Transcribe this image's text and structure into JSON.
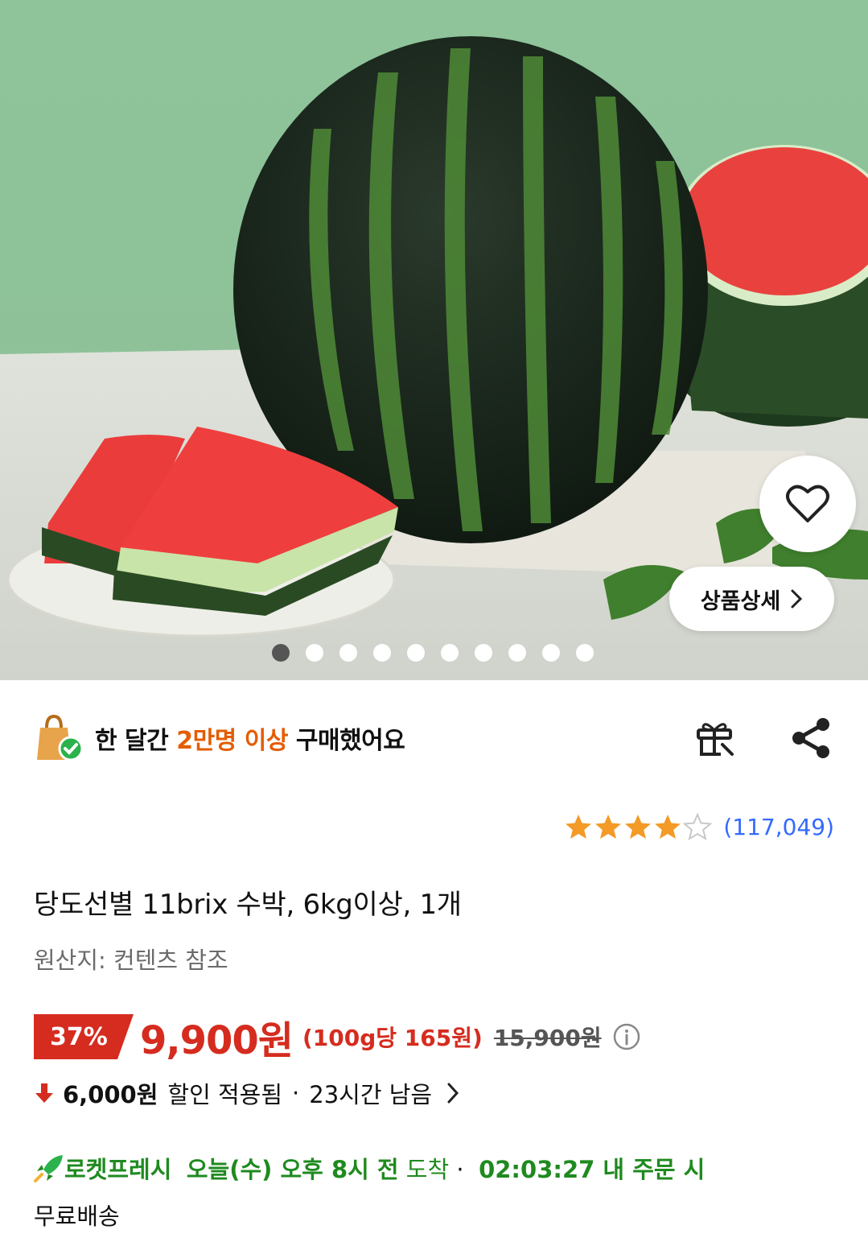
{
  "hero": {
    "image_alt": "",
    "detail_button_label": "상품상세",
    "page_count": 10,
    "active_page": 1
  },
  "social_proof": {
    "prefix": "한 달간 ",
    "highlight": "2만명 이상",
    "suffix": " 구매했어요"
  },
  "icons": {
    "bag": "shopping-bag-check-icon",
    "gift": "gift-icon",
    "share": "share-icon",
    "heart": "heart-icon",
    "info": "info-icon"
  },
  "rating": {
    "stars": 4,
    "max_stars": 5,
    "count_text": "(117,049)"
  },
  "product": {
    "title": "당도선별 11brix 수박, 6kg이상, 1개",
    "origin": "원산지: 컨텐츠 참조"
  },
  "price": {
    "discount_rate": "37%",
    "sale_price": "9,900원",
    "unit_price": "(100g당 165원)",
    "original_price": "15,900원"
  },
  "coupon": {
    "amount": "6,000원",
    "text": "할인 적용됨",
    "separator": "·",
    "remaining": "23시간 남음"
  },
  "delivery": {
    "badge": "로켓프레시",
    "arrival": "오늘(수) 오후 8시 전",
    "arrival_suffix": " 도착",
    "separator": " · ",
    "countdown": "02:03:27",
    "countdown_suffix": " 내 주문 시",
    "free_shipping": "무료배송"
  },
  "colors": {
    "accent_red": "#d52c1f",
    "highlight_orange": "#e45c00",
    "rating_blue": "#346aff",
    "star_orange": "#f39a27",
    "rocket_green": "#1f8a1f"
  }
}
